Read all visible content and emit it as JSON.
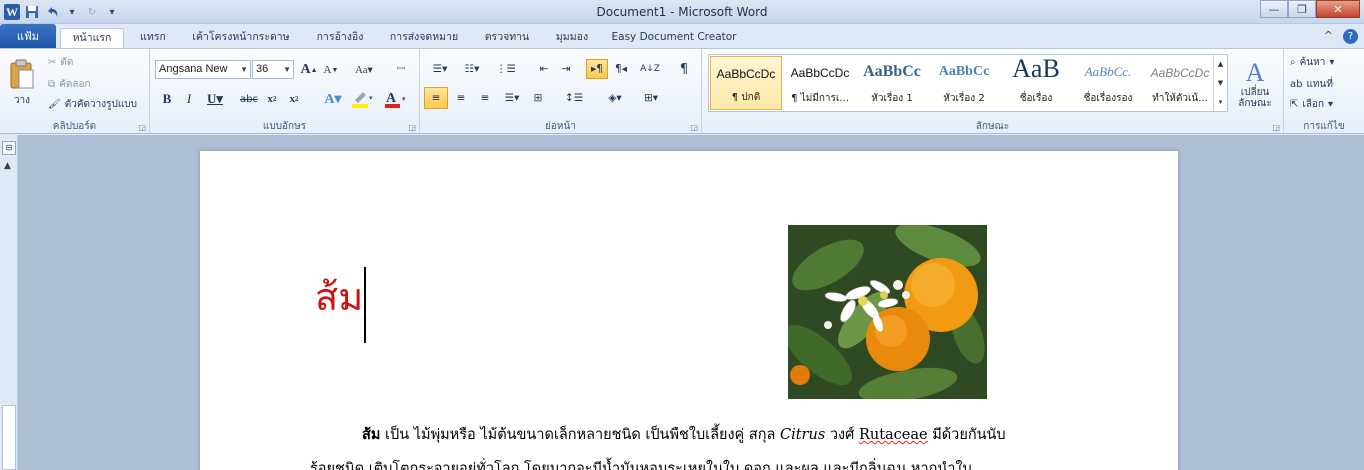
{
  "window": {
    "title": "Document1 - Microsoft Word",
    "minimize_label": "—",
    "restore_label": "❐",
    "close_label": "✕"
  },
  "qat": {
    "logo_label": "W",
    "customize_label": "▾"
  },
  "tabs": {
    "file": "แฟ้ม",
    "items": [
      {
        "label": "หน้าแรก"
      },
      {
        "label": "แทรก"
      },
      {
        "label": "เค้าโครงหน้ากระดาษ"
      },
      {
        "label": "การอ้างอิง"
      },
      {
        "label": "การส่งจดหมาย"
      },
      {
        "label": "ตรวจทาน"
      },
      {
        "label": "มุมมอง"
      },
      {
        "label": "Easy Document Creator"
      }
    ],
    "active_index": 0,
    "help_label": "?",
    "collapse_label": "^"
  },
  "clipboard": {
    "paste_label": "วาง",
    "cut_label": "ตัด",
    "copy_label": "คัดลอก",
    "format_painter_label": "ตัวคัดวางรูปแบบ",
    "group_label": "คลิปบอร์ด"
  },
  "font": {
    "font_name": "Angsana New",
    "font_size": "36",
    "group_label": "แบบอักษร"
  },
  "paragraph": {
    "group_label": "ย่อหน้า"
  },
  "styles": {
    "items": [
      {
        "sample": "AaBbCcDc",
        "name": "¶ ปกติ"
      },
      {
        "sample": "AaBbCcDc",
        "name": "¶ ไม่มีการเ..."
      },
      {
        "sample": "AaBbCc",
        "name": "หัวเรื่อง 1"
      },
      {
        "sample": "AaBbCc",
        "name": "หัวเรื่อง 2"
      },
      {
        "sample": "AaB",
        "name": "ชื่อเรื่อง"
      },
      {
        "sample": "AaBbCc.",
        "name": "ชื่อเรื่องรอง"
      },
      {
        "sample": "AaBbCcDc",
        "name": "ทำให้ตัวเน้..."
      }
    ],
    "change_styles_label": "เปลี่ยน ลักษณะ",
    "group_label": "ลักษณะ"
  },
  "editing": {
    "find_label": "ค้นหา",
    "replace_label": "แทนที่",
    "select_label": "เลือก",
    "group_label": "การแก้ไข"
  },
  "document": {
    "title": "ส้ม",
    "para_bold": "ส้ม",
    "para_text1": " เป็น ไม้พุ่มหรือ ไม้ต้นขนาดเล็กหลายชนิด เป็นพืชใบเลี้ยงคู่ สกุล ",
    "para_italic": "Citrus",
    "para_text2": " วงศ์ ",
    "para_family": "Rutaceae",
    "para_text3": " มีด้วยกันนับ",
    "para_line2": "ร้อยชนิด เติบโตกระจายอยู่ทั่วโลก โดยมากจะมีน้ำมันหอมระเหยในใบ ดอก และผล และมีกลิ่นฉุน หากนำใบ"
  },
  "colors": {
    "title_red": "#d01010",
    "accent_blue": "#1f56a8"
  }
}
